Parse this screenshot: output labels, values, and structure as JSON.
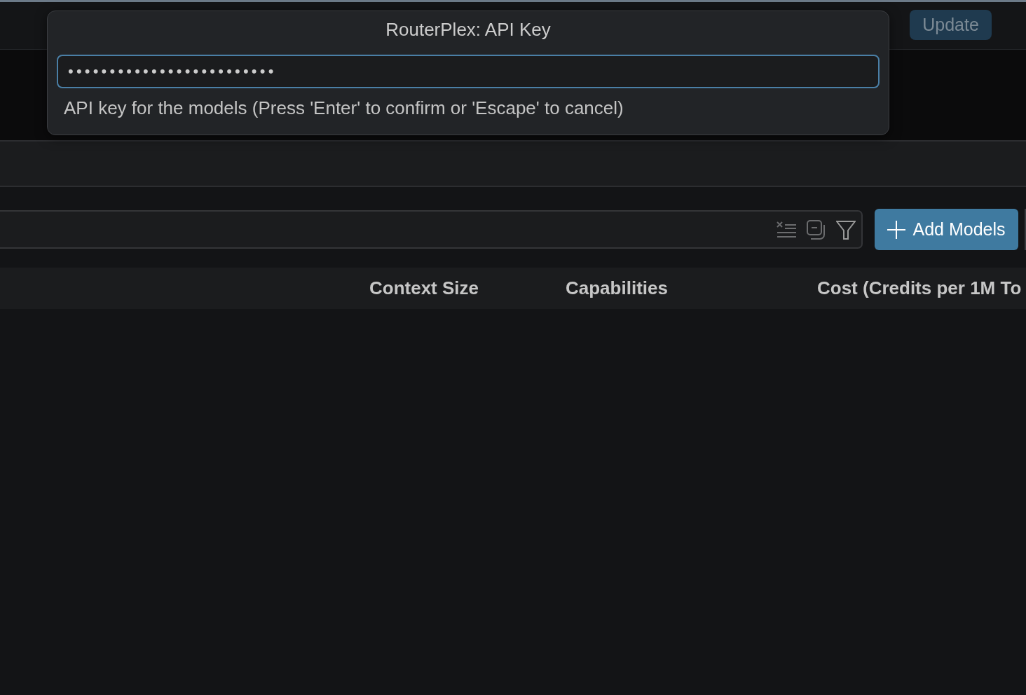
{
  "header": {
    "update_button": {
      "label": "Update",
      "disabled": true
    }
  },
  "quick_input": {
    "title": "RouterPlex: API Key",
    "input": {
      "value": "•••••••••••••••••••••••••",
      "focused": true
    },
    "message": "API key for the models (Press 'Enter' to confirm or 'Escape' to cancel)"
  },
  "toolbar": {
    "add_button": {
      "label": "Add Models"
    }
  },
  "table": {
    "columns": [
      {
        "label": "Context Size"
      },
      {
        "label": "Capabilities"
      },
      {
        "label": "Cost (Credits per 1M To"
      }
    ]
  }
}
